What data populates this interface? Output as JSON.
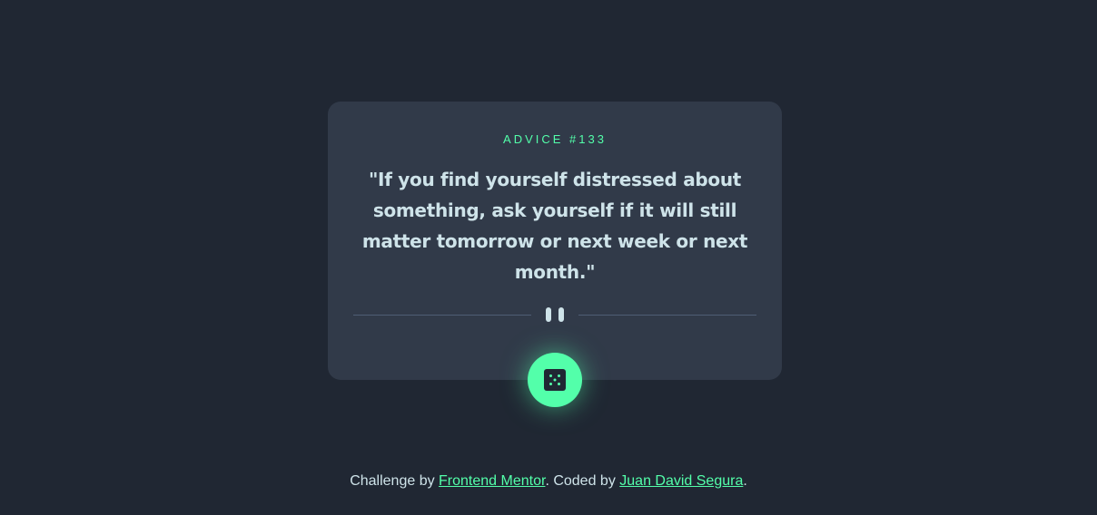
{
  "card": {
    "advice_label": "ADVICE #133",
    "quote": "\"If you find yourself distressed about something, ask yourself if it will still matter tomorrow or next week or next month.\""
  },
  "dice_button": {
    "icon": "dice-icon"
  },
  "footer": {
    "prefix": "Challenge by ",
    "challenge_link": "Frontend Mentor",
    "middle": ". Coded by ",
    "author_link": "Juan David Segura",
    "suffix": "."
  },
  "colors": {
    "background": "#202733",
    "card": "#313a49",
    "accent": "#53ffaa",
    "text": "#cee3e9",
    "divider": "#4f5d74"
  }
}
